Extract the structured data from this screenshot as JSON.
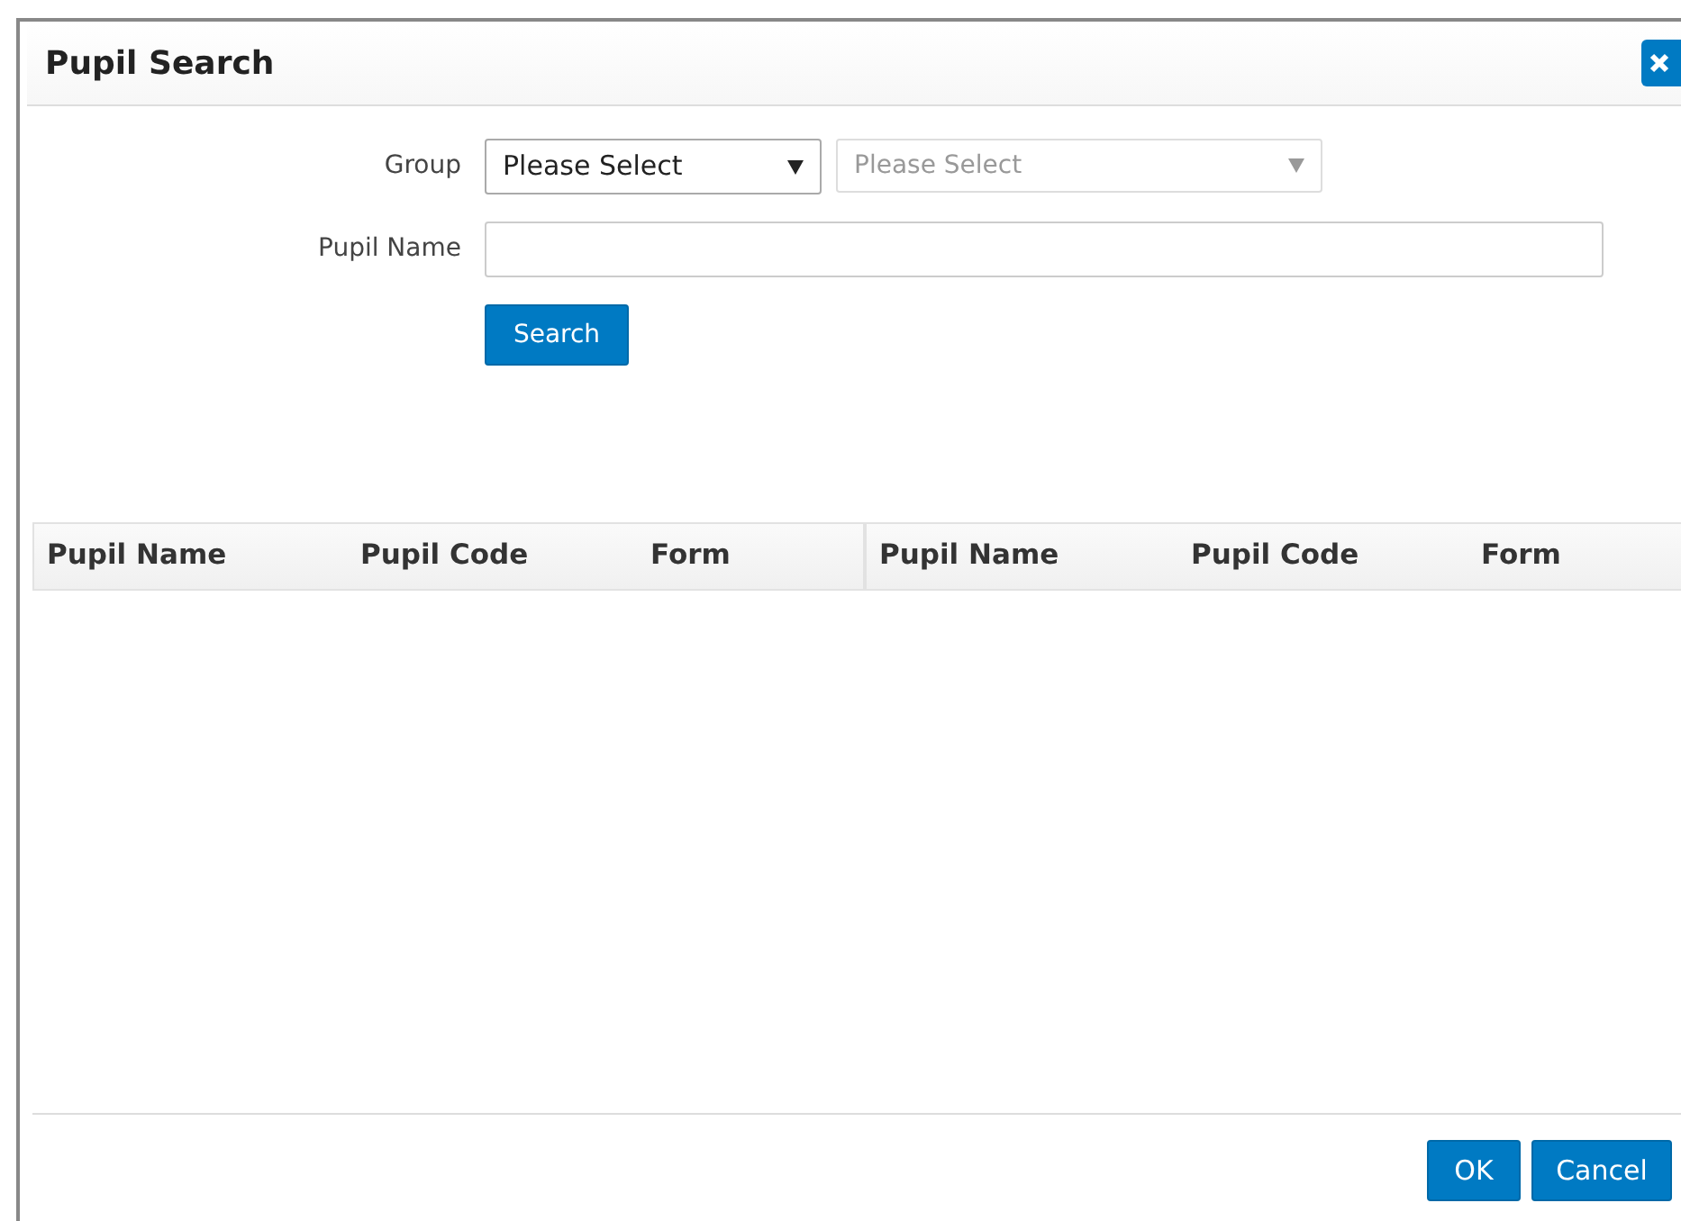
{
  "dialog": {
    "title": "Pupil Search"
  },
  "form": {
    "group_label": "Group",
    "selects": [
      {
        "value": "Please Select",
        "disabled": false
      },
      {
        "value": "Please Select",
        "disabled": true
      }
    ],
    "name_label": "Pupil Name",
    "search_button": "Search"
  },
  "tables": [
    {
      "columns": [
        "Pupil Name",
        "Pupil Code",
        "Form"
      ]
    },
    {
      "columns": [
        "Pupil Name",
        "Pupil Code",
        "Form"
      ]
    }
  ],
  "buttons": [
    "OK",
    "Cancel"
  ]
}
